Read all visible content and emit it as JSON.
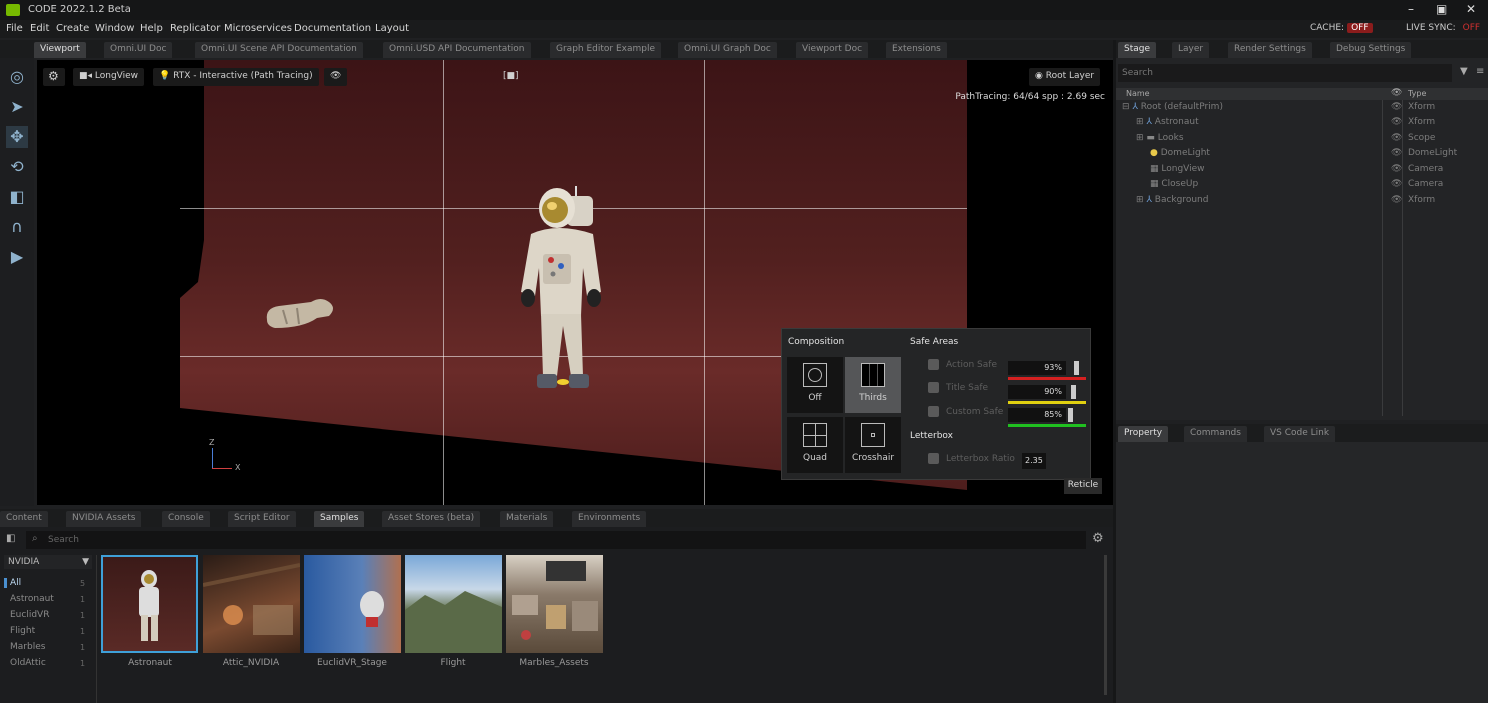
{
  "app": {
    "title": "CODE 2022.1.2 Beta"
  },
  "menu": [
    "File",
    "Edit",
    "Create",
    "Window",
    "Help",
    "Replicator",
    "Microservices",
    "Documentation",
    "Layout"
  ],
  "cache": {
    "label": "CACHE:",
    "state": "OFF"
  },
  "live_sync": {
    "label": "LIVE SYNC:",
    "state": "OFF"
  },
  "top_tabs": [
    "Viewport",
    "Omni.UI Doc",
    "Omni.UI Scene API Documentation",
    "Omni.USD API Documentation",
    "Graph Editor Example",
    "Omni.UI Graph Doc",
    "Viewport Doc",
    "Extensions"
  ],
  "viewport": {
    "camera": "LongView",
    "renderer": "RTX - Interactive (Path Tracing)",
    "layer": "Root Layer",
    "pathtracing": "PathTracing: 64/64 spp : 2.69 sec",
    "axis_z": "Z",
    "axis_x": "X"
  },
  "composition": {
    "title": "Composition",
    "off": "Off",
    "thirds": "Thirds",
    "quad": "Quad",
    "crosshair": "Crosshair",
    "safe_areas": "Safe Areas",
    "action_safe": "Action Safe",
    "title_safe": "Title Safe",
    "custom_safe": "Custom Safe",
    "action_pct": "93%",
    "title_pct": "90%",
    "custom_pct": "85%",
    "letterbox": "Letterbox",
    "letterbox_ratio": "Letterbox Ratio",
    "letterbox_value": "2.35",
    "reticle": "Reticle",
    "colors": {
      "action": "#d42020",
      "title": "#e0d010",
      "custom": "#20c020"
    }
  },
  "stage": {
    "tabs": [
      "Stage",
      "Layer",
      "Render Settings",
      "Debug Settings"
    ],
    "search": "Search",
    "col_name": "Name",
    "col_type": "Type",
    "rows": [
      {
        "name": "Root (defaultPrim)",
        "type": "Xform"
      },
      {
        "name": "Astronaut",
        "type": "Xform"
      },
      {
        "name": "Looks",
        "type": "Scope"
      },
      {
        "name": "DomeLight",
        "type": "DomeLight"
      },
      {
        "name": "LongView",
        "type": "Camera"
      },
      {
        "name": "CloseUp",
        "type": "Camera"
      },
      {
        "name": "Background",
        "type": "Xform"
      }
    ]
  },
  "property_tabs": [
    "Property",
    "Commands",
    "VS Code Link"
  ],
  "bottom_tabs": [
    "Content",
    "NVIDIA Assets",
    "Console",
    "Script Editor",
    "Samples",
    "Asset Stores (beta)",
    "Materials",
    "Environments"
  ],
  "samples": {
    "search": "Search",
    "source": "NVIDIA",
    "categories": [
      {
        "name": "All",
        "count": "5"
      },
      {
        "name": "Astronaut",
        "count": "1"
      },
      {
        "name": "EuclidVR",
        "count": "1"
      },
      {
        "name": "Flight",
        "count": "1"
      },
      {
        "name": "Marbles",
        "count": "1"
      },
      {
        "name": "OldAttic",
        "count": "1"
      }
    ],
    "items": [
      "Astronaut",
      "Attic_NVIDIA",
      "EuclidVR_Stage",
      "Flight",
      "Marbles_Assets"
    ]
  }
}
